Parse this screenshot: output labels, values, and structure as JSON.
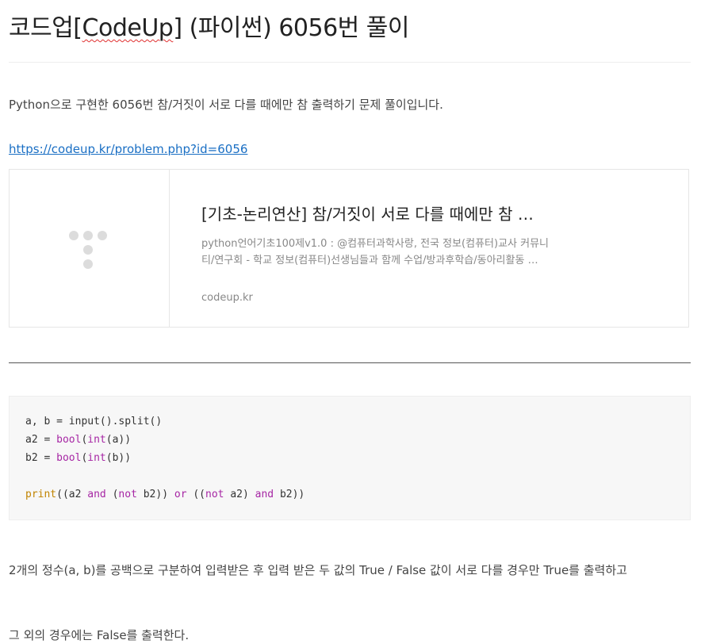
{
  "post": {
    "title_prefix": "코드업[",
    "title_squiggle": "CodeUp",
    "title_suffix": "] (파이썬) 6056번 풀이",
    "intro": "Python으로 구현한 6056번 참/거짓이 서로 다를 때에만 참 출력하기 문제 풀이입니다.",
    "link_text": "https://codeup.kr/problem.php?id=6056"
  },
  "card": {
    "title": "[기초-논리연산] 참/거짓이 서로 다를 때에만 참 …",
    "desc_line1": "python언어기초100제v1.0 : @컴퓨터과학사랑, 전국 정보(컴퓨터)교사 커뮤니",
    "desc_line2": "티/연구회 - 학교 정보(컴퓨터)선생님들과 함께 수업/방과후학습/동아리활동 …",
    "domain": "codeup.kr",
    "thumb_icon": "codeup-logo-icon"
  },
  "code": {
    "line1": "a, b = input().split()",
    "line2_a": "a2 = ",
    "line2_b": "bool",
    "line2_c": "(",
    "line2_d": "int",
    "line2_e": "(a))",
    "line3_a": "b2 = ",
    "line3_b": "bool",
    "line3_c": "(",
    "line3_d": "int",
    "line3_e": "(b))",
    "line5_print": "print",
    "line5_t1": "((a2 ",
    "line5_and1": "and",
    "line5_t2": " (",
    "line5_not1": "not",
    "line5_t3": " b2)) ",
    "line5_or": "or",
    "line5_t4": " ((",
    "line5_not2": "not",
    "line5_t5": " a2) ",
    "line5_and2": "and",
    "line5_t6": " b2))"
  },
  "body": {
    "para1": "2개의 정수(a, b)를 공백으로 구분하여 입력받은 후 입력 받은 두 값의 True / False 값이 서로 다를 경우만 True를 출력하고",
    "para2": "그 외의 경우에는 False를 출력한다."
  },
  "colors": {
    "link": "#1a6fc4",
    "code_bg": "#f7f7f7",
    "keyword": "#a626a4",
    "function": "#c18401"
  }
}
